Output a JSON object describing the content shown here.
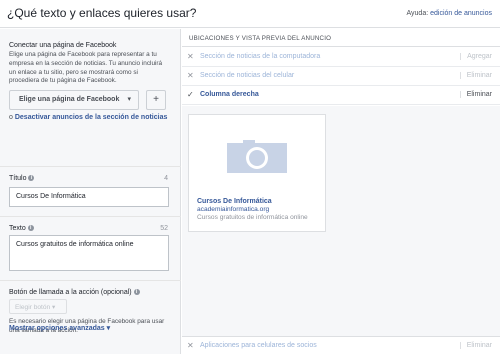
{
  "header": {
    "title": "¿Qué texto y enlaces quieres usar?",
    "help_prefix": "Ayuda:",
    "help_link": "edición de anuncios"
  },
  "page_section": {
    "label": "Conectar una página de Facebook",
    "description": "Elige una página de Facebook para representar a tu empresa en la sección de noticias. Tu anuncio incluirá un enlace a tu sitio, pero se mostrará como si procediera de tu página de Facebook.",
    "select_label": "Elige una página de Facebook",
    "select_caret": "▾",
    "add_label": "+",
    "deactivate_prefix": "o",
    "deactivate_link": "Desactivar anuncios de la sección de noticias"
  },
  "title_field": {
    "label": "Título",
    "count": "4",
    "value": "Cursos De Informática"
  },
  "text_field": {
    "label": "Texto",
    "count": "52",
    "value": "Cursos gratuitos de informática online"
  },
  "cta": {
    "label": "Botón de llamada a la acción",
    "optional": "(opcional)",
    "button": "Elegir botón",
    "caret": "▾",
    "note": "Es necesario elegir una página de Facebook para usar una llamada a la acción."
  },
  "advanced": {
    "label": "Mostrar opciones avanzadas",
    "caret": "▾"
  },
  "preview": {
    "header": "UBICACIONES Y VISTA PREVIA DEL ANUNCIO",
    "placements": [
      {
        "icon": "close-icon",
        "glyph": "✕",
        "name": "Sección de noticias de la computadora",
        "action": "Agregar"
      },
      {
        "icon": "close-icon",
        "glyph": "✕",
        "name": "Sección de noticias del celular",
        "action": "Eliminar"
      },
      {
        "icon": "check-icon",
        "glyph": "✓",
        "name": "Columna derecha",
        "action": "Eliminar"
      }
    ],
    "card": {
      "title": "Cursos De Informática",
      "url": "academiainformatica.org",
      "text": "Cursos gratuitos de informática online"
    },
    "bottom": {
      "icon": "close-icon",
      "glyph": "✕",
      "name": "Aplicaciones para celulares de socios",
      "action": "Eliminar"
    }
  },
  "colors": {
    "link": "#365899",
    "panel_bg": "#f6f7f9",
    "border": "#dddfe2",
    "placeholder_image": "#c8d3e6"
  }
}
